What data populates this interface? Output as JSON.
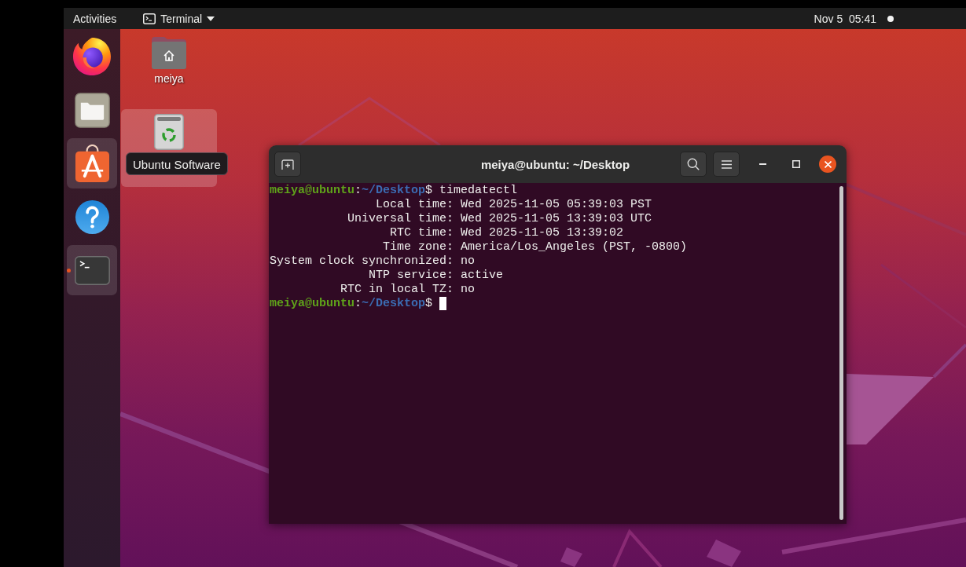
{
  "top_bar": {
    "activities": "Activities",
    "app_menu": "Terminal",
    "clock": "Nov 5  05:41"
  },
  "dock": {
    "items": [
      {
        "kind": "browser",
        "highlighted": false,
        "running": false
      },
      {
        "kind": "files",
        "highlighted": false,
        "running": false
      },
      {
        "kind": "software",
        "highlighted": true,
        "running": false
      },
      {
        "kind": "help",
        "highlighted": false,
        "running": false
      },
      {
        "kind": "terminal",
        "highlighted": true,
        "running": true
      }
    ],
    "tooltip": "Ubuntu Software"
  },
  "desktop": {
    "icons": [
      {
        "kind": "home",
        "label": "meiya",
        "selected": false
      },
      {
        "kind": "trash",
        "selected": true
      }
    ]
  },
  "terminal": {
    "title": "meiya@ubuntu: ~/Desktop",
    "lines": [
      {
        "kind": "prompt",
        "user": "meiya@ubuntu",
        "separator": ":",
        "path": "~/Desktop",
        "symbol": "$",
        "command": "timedatectl"
      },
      {
        "kind": "field",
        "label": "Local time:",
        "value": "Wed 2025-11-05 05:39:03 PST"
      },
      {
        "kind": "field",
        "label": "Universal time:",
        "value": "Wed 2025-11-05 13:39:03 UTC"
      },
      {
        "kind": "field",
        "label": "RTC time:",
        "value": "Wed 2025-11-05 13:39:02"
      },
      {
        "kind": "field",
        "label": "Time zone:",
        "value": "America/Los_Angeles (PST, -0800)"
      },
      {
        "kind": "field",
        "label": "System clock synchronized:",
        "value": "no"
      },
      {
        "kind": "field",
        "label": "NTP service:",
        "value": "active"
      },
      {
        "kind": "field",
        "label": "RTC in local TZ:",
        "value": "no"
      },
      {
        "kind": "prompt",
        "user": "meiya@ubuntu",
        "separator": ":",
        "path": "~/Desktop",
        "symbol": "$"
      }
    ],
    "cursor": true
  }
}
